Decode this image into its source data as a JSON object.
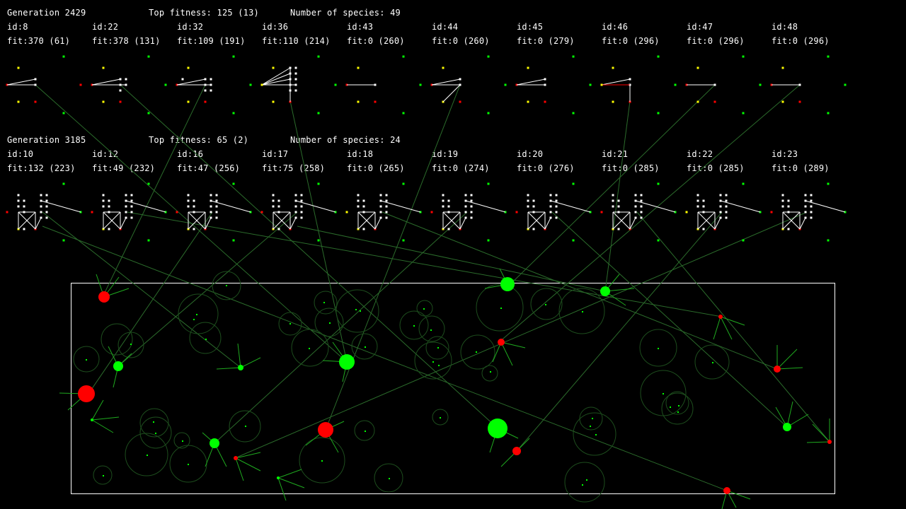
{
  "populations": [
    {
      "generation": "Generation 2429",
      "top_fitness": "Top fitness: 125 (13)",
      "species_count": "Number of species: 49",
      "genomes": [
        {
          "id": "id:8",
          "fit": "fit:370 (61)"
        },
        {
          "id": "id:22",
          "fit": "fit:378 (131)"
        },
        {
          "id": "id:32",
          "fit": "fit:109 (191)"
        },
        {
          "id": "id:36",
          "fit": "fit:110 (214)"
        },
        {
          "id": "id:43",
          "fit": "fit:0 (260)"
        },
        {
          "id": "id:44",
          "fit": "fit:0 (260)"
        },
        {
          "id": "id:45",
          "fit": "fit:0 (279)"
        },
        {
          "id": "id:46",
          "fit": "fit:0 (296)"
        },
        {
          "id": "id:47",
          "fit": "fit:0 (296)"
        },
        {
          "id": "id:48",
          "fit": "fit:0 (296)"
        }
      ]
    },
    {
      "generation": "Generation 3185",
      "top_fitness": "Top fitness: 65 (2)",
      "species_count": "Number of species: 24",
      "genomes": [
        {
          "id": "id:10",
          "fit": "fit:132 (223)"
        },
        {
          "id": "id:12",
          "fit": "fit:49 (232)"
        },
        {
          "id": "id:16",
          "fit": "fit:47 (256)"
        },
        {
          "id": "id:17",
          "fit": "fit:75 (258)"
        },
        {
          "id": "id:18",
          "fit": "fit:0 (265)"
        },
        {
          "id": "id:19",
          "fit": "fit:0 (274)"
        },
        {
          "id": "id:20",
          "fit": "fit:0 (276)"
        },
        {
          "id": "id:21",
          "fit": "fit:0 (285)"
        },
        {
          "id": "id:22",
          "fit": "fit:0 (285)"
        },
        {
          "id": "id:23",
          "fit": "fit:0 (289)"
        }
      ]
    }
  ],
  "colors": {
    "background": "#000000",
    "text": "#ffffff",
    "green_agent": "#00ff00",
    "red_agent": "#ff0000",
    "sensor_yellow": "#ffff00",
    "link": "#2a6a2a"
  }
}
